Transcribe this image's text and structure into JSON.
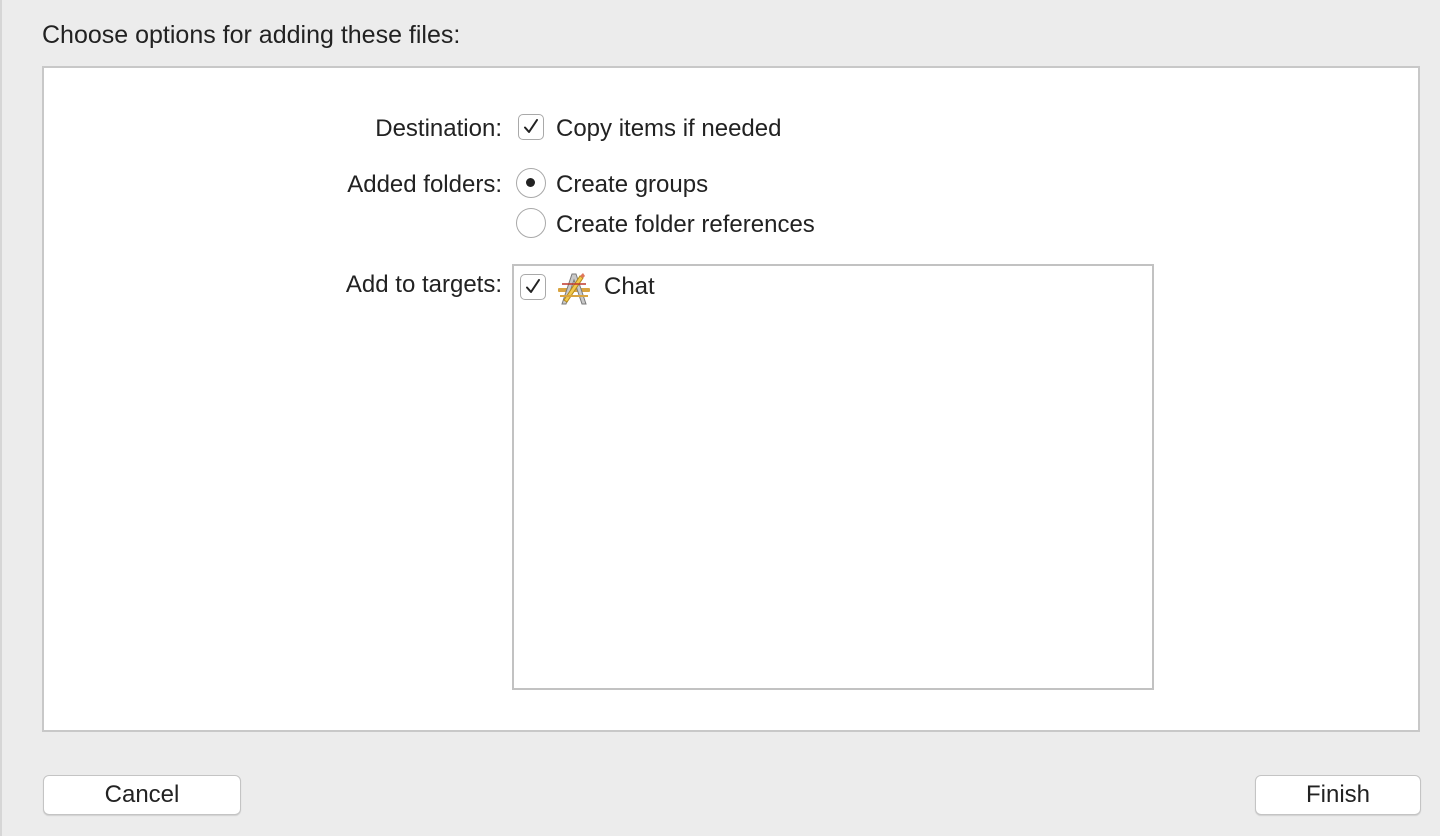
{
  "heading": "Choose options for adding these files:",
  "destination": {
    "label": "Destination:",
    "checkbox_label": "Copy items if needed",
    "checked": true
  },
  "added_folders": {
    "label": "Added folders:",
    "options": [
      {
        "label": "Create groups",
        "selected": true
      },
      {
        "label": "Create folder references",
        "selected": false
      }
    ]
  },
  "targets": {
    "label": "Add to targets:",
    "items": [
      {
        "name": "Chat",
        "checked": true,
        "icon": "xcode-app-icon"
      }
    ]
  },
  "buttons": {
    "cancel": "Cancel",
    "finish": "Finish"
  }
}
